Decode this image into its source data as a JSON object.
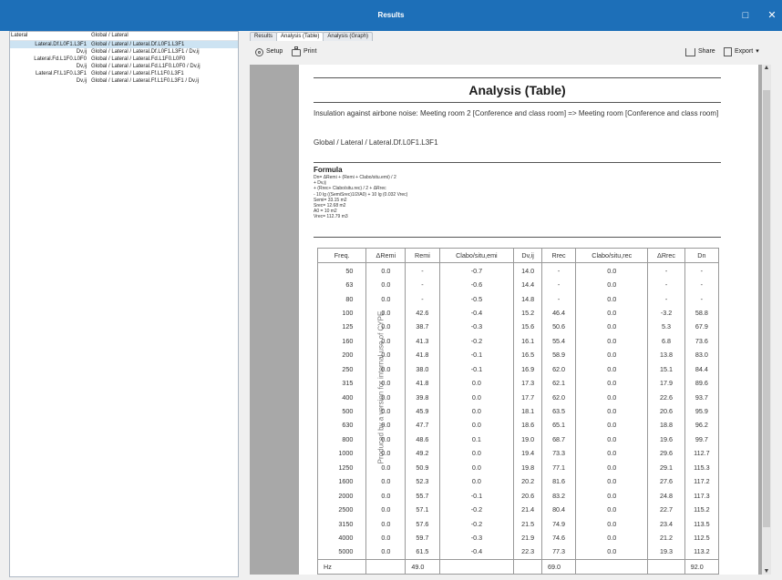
{
  "window": {
    "title": "Results",
    "maximize_glyph": "□",
    "close_glyph": "✕"
  },
  "tree": {
    "header": [
      "Lateral",
      "Global / Lateral"
    ],
    "rows": [
      {
        "name": "Lateral.Df.L0F1.L3F1",
        "path": "Global / Lateral / Lateral.Df.L0F1.L3F1",
        "selected": true,
        "root": false
      },
      {
        "name": "Dv,ij",
        "path": "Global / Lateral / Lateral.Df.L0F1.L3F1 / Dv,ij",
        "selected": false,
        "root": false
      },
      {
        "name": "Lateral.Fd.L1F0.L0F0",
        "path": "Global / Lateral / Lateral.Fd.L1F0.L0F0",
        "selected": false,
        "root": false
      },
      {
        "name": "Dv,ij",
        "path": "Global / Lateral / Lateral.Fd.L1F0.L0F0 / Dv,ij",
        "selected": false,
        "root": false
      },
      {
        "name": "Lateral.Ff.L1F0.L3F1",
        "path": "Global / Lateral / Lateral.Ff.L1F0.L3F1",
        "selected": false,
        "root": false
      },
      {
        "name": "Dv,ij",
        "path": "Global / Lateral / Lateral.Ff.L1F0.L3F1 / Dv,ij",
        "selected": false,
        "root": false
      }
    ]
  },
  "tabs": [
    {
      "label": "Results",
      "active": false
    },
    {
      "label": "Analysis (Table)",
      "active": true
    },
    {
      "label": "Analysis (Graph)",
      "active": false
    }
  ],
  "toolbar": {
    "setup": "Setup",
    "print": "Print",
    "share": "Share",
    "export": "Export"
  },
  "report": {
    "title": "Analysis (Table)",
    "description": "Insulation against airbone noise: Meeting room 2 [Conference and class room] => Meeting room [Conference and class room]",
    "path": "Global / Lateral / Lateral.Df.L0F1.L3F1",
    "formula_heading": "Formula",
    "formula_lines": [
      "Dn= ΔRemi + (Remi + Clabo/situ.emi) / 2",
      "   + Dv,ij",
      "   + (Rrec+ Clabo/situ.rec) / 2 + ΔRrec",
      "   - 10 lg ((SemiSrec)1/2/A0) + 10 lg (0.032 Vrec)",
      "Semi= 33.15 m2",
      "Srec= 12.68 m2",
      "A0 = 10 m2",
      "Vrec= 112.79 m3"
    ],
    "watermark": "Produced by a version for internal use of CYPE",
    "table": {
      "headers": [
        "Freq.",
        "ΔRemi",
        "Remi",
        "Clabo/situ,emi",
        "Dv,ij",
        "Rrec",
        "Clabo/situ,rec",
        "ΔRrec",
        "Dn"
      ],
      "rows": [
        [
          "50",
          "0.0",
          "-",
          "-0.7",
          "14.0",
          "-",
          "0.0",
          "-",
          "-"
        ],
        [
          "63",
          "0.0",
          "-",
          "-0.6",
          "14.4",
          "-",
          "0.0",
          "-",
          "-"
        ],
        [
          "80",
          "0.0",
          "-",
          "-0.5",
          "14.8",
          "-",
          "0.0",
          "-",
          "-"
        ],
        [
          "100",
          "0.0",
          "42.6",
          "-0.4",
          "15.2",
          "46.4",
          "0.0",
          "-3.2",
          "58.8"
        ],
        [
          "125",
          "0.0",
          "38.7",
          "-0.3",
          "15.6",
          "50.6",
          "0.0",
          "5.3",
          "67.9"
        ],
        [
          "160",
          "0.0",
          "41.3",
          "-0.2",
          "16.1",
          "55.4",
          "0.0",
          "6.8",
          "73.6"
        ],
        [
          "200",
          "0.0",
          "41.8",
          "-0.1",
          "16.5",
          "58.9",
          "0.0",
          "13.8",
          "83.0"
        ],
        [
          "250",
          "0.0",
          "38.0",
          "-0.1",
          "16.9",
          "62.0",
          "0.0",
          "15.1",
          "84.4"
        ],
        [
          "315",
          "0.0",
          "41.8",
          "0.0",
          "17.3",
          "62.1",
          "0.0",
          "17.9",
          "89.6"
        ],
        [
          "400",
          "0.0",
          "39.8",
          "0.0",
          "17.7",
          "62.0",
          "0.0",
          "22.6",
          "93.7"
        ],
        [
          "500",
          "0.0",
          "45.9",
          "0.0",
          "18.1",
          "63.5",
          "0.0",
          "20.6",
          "95.9"
        ],
        [
          "630",
          "0.0",
          "47.7",
          "0.0",
          "18.6",
          "65.1",
          "0.0",
          "18.8",
          "96.2"
        ],
        [
          "800",
          "0.0",
          "48.6",
          "0.1",
          "19.0",
          "68.7",
          "0.0",
          "19.6",
          "99.7"
        ],
        [
          "1000",
          "0.0",
          "49.2",
          "0.0",
          "19.4",
          "73.3",
          "0.0",
          "29.6",
          "112.7"
        ],
        [
          "1250",
          "0.0",
          "50.9",
          "0.0",
          "19.8",
          "77.1",
          "0.0",
          "29.1",
          "115.3"
        ],
        [
          "1600",
          "0.0",
          "52.3",
          "0.0",
          "20.2",
          "81.6",
          "0.0",
          "27.6",
          "117.2"
        ],
        [
          "2000",
          "0.0",
          "55.7",
          "-0.1",
          "20.6",
          "83.2",
          "0.0",
          "24.8",
          "117.3"
        ],
        [
          "2500",
          "0.0",
          "57.1",
          "-0.2",
          "21.4",
          "80.4",
          "0.0",
          "22.7",
          "115.2"
        ],
        [
          "3150",
          "0.0",
          "57.6",
          "-0.2",
          "21.5",
          "74.9",
          "0.0",
          "23.4",
          "113.5"
        ],
        [
          "4000",
          "0.0",
          "59.7",
          "-0.3",
          "21.9",
          "74.6",
          "0.0",
          "21.2",
          "112.5"
        ],
        [
          "5000",
          "0.0",
          "61.5",
          "-0.4",
          "22.3",
          "77.3",
          "0.0",
          "19.3",
          "113.2"
        ]
      ],
      "summary": [
        "Hz",
        "",
        "49.0",
        "",
        "",
        "69.0",
        "",
        "",
        "92.0"
      ]
    }
  }
}
